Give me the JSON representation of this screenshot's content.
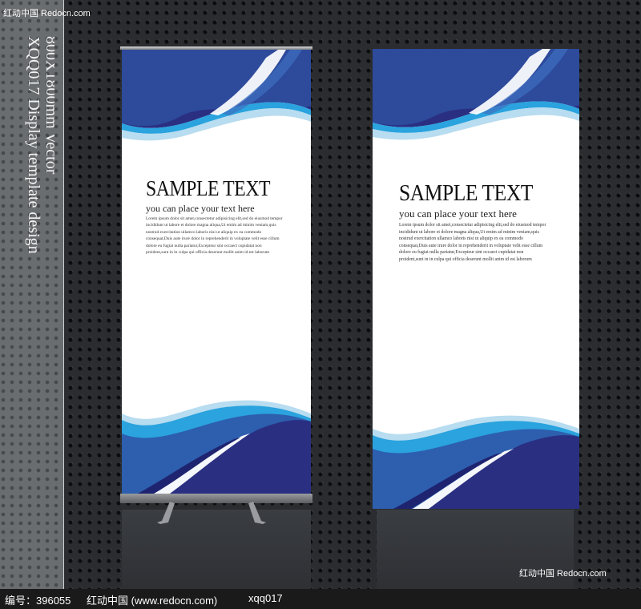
{
  "watermark_top": "红动中国 Redocn.com",
  "watermark_bottom": "红动中国 Redocn.com",
  "caption": {
    "line1": "XQQ017 Display template design",
    "line2": "800X1800mm Vector"
  },
  "banner": {
    "title": "SAMPLE TEXT",
    "subtitle": "you can place your text here",
    "body_lines": [
      "Lorem ipsum dolor sit amet,consectetur adipisicing elit,sed do eiusmod tempor",
      "incididunt ut labore et dolore magna aliqua,Ut emim ad minim veniam,quis",
      "nostrud exercitation ullamco laboris nisi ut aliquip ex ea commodo",
      "consequat,Duis aute irure dolor in reprehenderit in voluptate velit esse cillum",
      "dolore eu fugiat nulla pariatur,Excepteur sint occaect cupidatat non",
      "proident,sunt in in culpa qui officia deserunt mollit anim id est laborum"
    ]
  },
  "footer": {
    "id_label": "编号：396055",
    "site": "红动中国 (www.redocn.com)",
    "code": "xqq017"
  },
  "colors": {
    "navy": "#2a2f82",
    "royal_blue": "#2d5fae",
    "sky_blue": "#2aa3de",
    "pale_blue": "#b8dcf0",
    "background": "#2a2c2f"
  }
}
